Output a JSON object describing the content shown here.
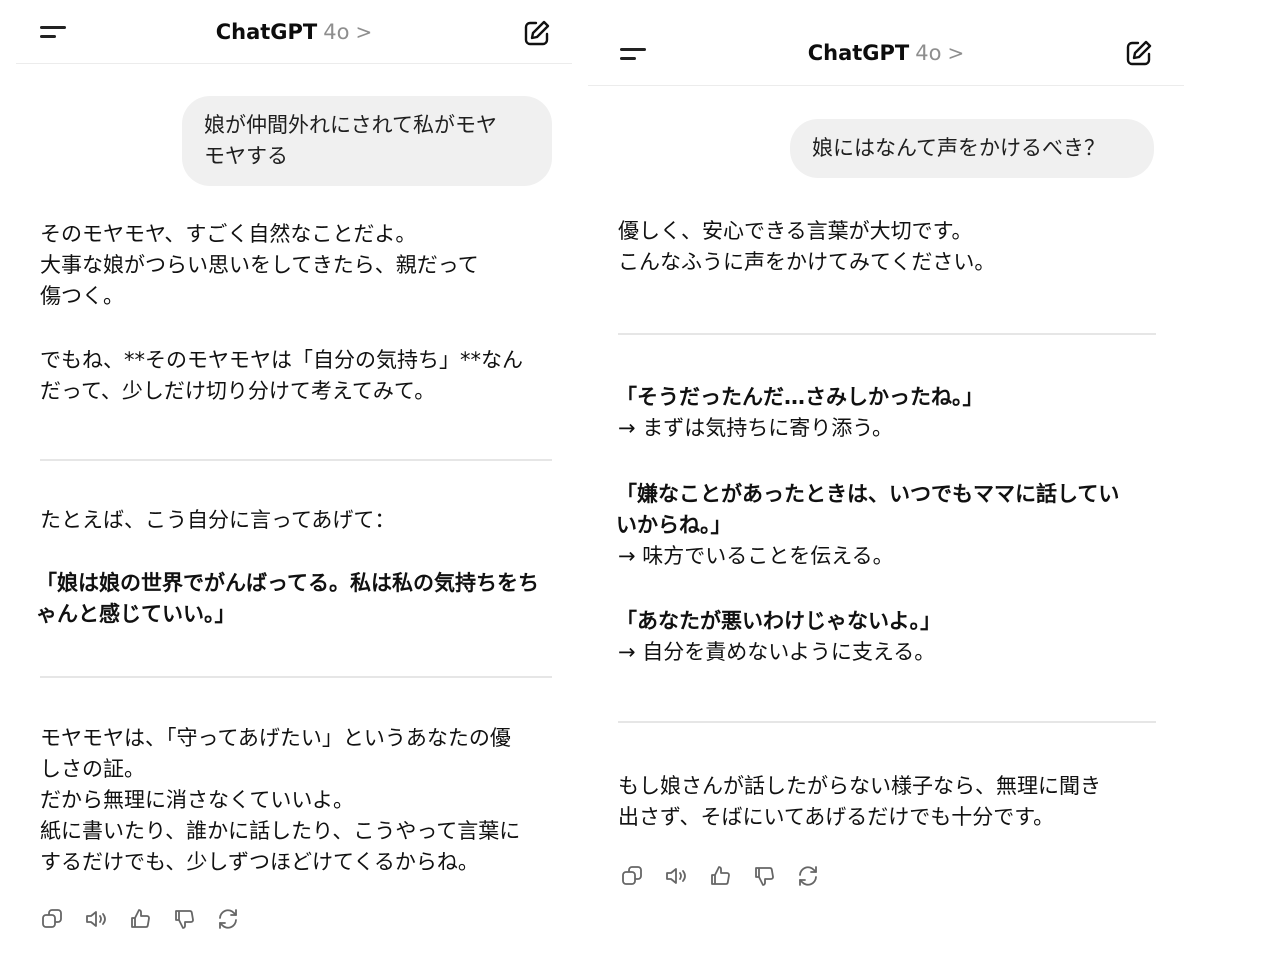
{
  "left": {
    "header": {
      "title": "ChatGPT",
      "model": "4o",
      "chevron": ">"
    },
    "user_message": "娘が仲間外れにされて私がモヤ\nモヤする",
    "para1": "そのモヤモヤ、すごく自然なことだよ。\n大事な娘がつらい思いをしてきたら、親だって\n傷つく。",
    "para2": "でもね、**そのモヤモヤは「自分の気持ち」**なん\nだって、少しだけ切り分けて考えてみて。",
    "para3": "たとえば、こう自分に言ってあげて：",
    "quote": "「娘は娘の世界でがんばってる。私は私の気持ちをち\nゃんと感じていい。」",
    "para4": "モヤモヤは、「守ってあげたい」というあなたの優\nしさの証。\nだから無理に消さなくていいよ。\n紙に書いたり、誰かに話したり、こうやって言葉に\nするだけでも、少しずつほどけてくるからね。"
  },
  "right": {
    "header": {
      "title": "ChatGPT",
      "model": "4o",
      "chevron": ">"
    },
    "user_message": "娘にはなんて声をかけるべき？",
    "intro": "優しく、安心できる言葉が大切です。\nこんなふうに声をかけてみてください。",
    "items": [
      {
        "quote": "「そうだったんだ…さみしかったね。」",
        "note": "→ まずは気持ちに寄り添う。"
      },
      {
        "quote": "「嫌なことがあったときは、いつでもママに話してい\nいからね。」",
        "note": "→ 味方でいることを伝える。"
      },
      {
        "quote": "「あなたが悪いわけじゃないよ。」",
        "note": "→ 自分を責めないように支える。"
      }
    ],
    "closing": "もし娘さんが話したがらない様子なら、無理に聞き\n出さず、そばにいてあげるだけでも十分です。"
  },
  "icons": {
    "menu": "menu-icon",
    "edit": "new-chat-icon",
    "copy": "copy-icon",
    "speaker": "read-aloud-icon",
    "thumbs_up": "thumbs-up-icon",
    "thumbs_down": "thumbs-down-icon",
    "regenerate": "regenerate-icon"
  }
}
